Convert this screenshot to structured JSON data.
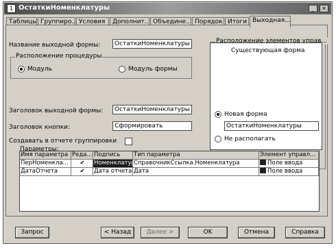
{
  "window": {
    "title": "ОстаткиНоменклатуры",
    "minimize": "_",
    "close": "✕"
  },
  "tabs": [
    {
      "label": "Таблицы..."
    },
    {
      "label": "Группиро..."
    },
    {
      "label": "Условия"
    },
    {
      "label": "Дополнит..."
    },
    {
      "label": "Объедине..."
    },
    {
      "label": "Порядок"
    },
    {
      "label": "Итоги"
    },
    {
      "label": "Выходная..."
    }
  ],
  "form": {
    "output_form_name_label": "Название выходной формы:",
    "output_form_name_value": "ОстаткиНоменклатуры",
    "procedure_group_title": "Расположение процедуры",
    "radio_module": "Модуль",
    "radio_form_module": "Модуль формы",
    "output_form_header_label": "Заголовок выходной формы:",
    "output_form_header_value": "ОстаткиНоменклатуры",
    "button_header_label": "Заголовок кнопки:",
    "button_header_value": "Сформировать",
    "create_groupings_label": "Создавать в отчете группировки",
    "params_label": "Параметры:"
  },
  "controls_group": {
    "title": "Расположение элементов управ...",
    "existing_form": "Существующая форма",
    "radio_new_form": "Новая форма",
    "new_form_value": "ОстаткиНоменклатуры",
    "radio_no_place": "Не располагать"
  },
  "params_table": {
    "headers": [
      "Имя параметра",
      "Реда...",
      "Подпись",
      "Тип параметра",
      "Элемент управл..."
    ],
    "rows": [
      {
        "name": "ПерНоменкла...",
        "edit": "✔",
        "caption": "Номенклатура",
        "type": "СправочникСсылка.Номенклатура",
        "control": "Поле ввода"
      },
      {
        "name": "ДатаОтчета",
        "edit": "✔",
        "caption": "Дата отчета",
        "type": "Дата",
        "control": "Поле ввода"
      }
    ]
  },
  "buttons": {
    "query": "Запрос",
    "back": "< Назад",
    "next": "Далее >",
    "ok": "OK",
    "cancel": "Отмена",
    "help": "Справка"
  }
}
